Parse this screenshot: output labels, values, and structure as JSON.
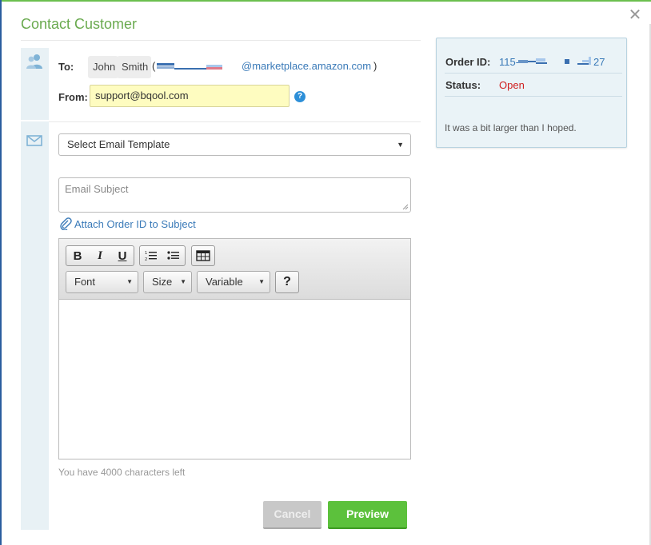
{
  "dialog": {
    "title": "Contact Customer",
    "close_glyph": "✕"
  },
  "recipient": {
    "to_label": "To:",
    "first_name": "John",
    "last_name": "Smith",
    "paren_open": "(",
    "email_domain": "@marketplace.amazon.com",
    "paren_close": ")"
  },
  "sender": {
    "from_label": "From:",
    "from_value": "support@bqool.com",
    "help_glyph": "?"
  },
  "compose": {
    "template_select": "Select Email Template",
    "select_caret": "▼",
    "subject_placeholder": "Email Subject",
    "attach_link": "Attach Order ID to Subject",
    "chars_left": "You have 4000 characters left"
  },
  "toolbar": {
    "bold": "B",
    "italic": "I",
    "underline": "U",
    "font_dropdown": "Font",
    "size_dropdown": "Size",
    "variable_dropdown": "Variable",
    "help": "?",
    "caret": "▼"
  },
  "actions": {
    "cancel": "Cancel",
    "preview": "Preview"
  },
  "order": {
    "order_id_label": "Order ID:",
    "order_id_prefix": "115-",
    "order_id_suffix": "27",
    "status_label": "Status:",
    "status_value": "Open",
    "message": "It was a bit larger than I hoped."
  },
  "colors": {
    "title_green": "#6aaa4f",
    "link_blue": "#3a7ab8",
    "status_red": "#d02020",
    "preview_green": "#5cc13c",
    "from_yellow": "#fefcc0"
  },
  "icons": {
    "recipients": "users-icon",
    "compose": "envelope-icon",
    "attach": "paperclip-icon",
    "help": "question-icon",
    "close": "close-icon"
  }
}
